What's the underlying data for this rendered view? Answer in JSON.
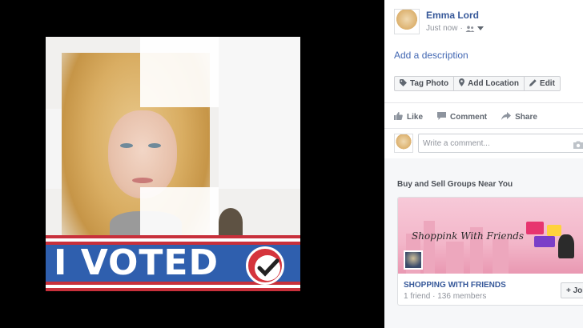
{
  "post": {
    "author": "Emma Lord",
    "timestamp": "Just now",
    "separator": "·",
    "description_link": "Add a description"
  },
  "photo": {
    "banner_text": "I VOTED"
  },
  "tools": {
    "tag_photo": "Tag Photo",
    "add_location": "Add Location",
    "edit": "Edit"
  },
  "actions": {
    "like": "Like",
    "comment": "Comment",
    "share": "Share"
  },
  "comment": {
    "placeholder": "Write a comment..."
  },
  "suggestions": {
    "title": "Buy and Sell Groups Near You",
    "group": {
      "image_text": "Shoppink With Friends",
      "name": "SHOPPING WITH FRIENDS",
      "meta": "1 friend · 136 members",
      "join_label": "+ Join"
    }
  },
  "icons": {
    "privacy": "friends-icon",
    "dropdown": "caret-down-icon",
    "tag": "tag-icon",
    "location": "location-pin-icon",
    "edit": "pencil-icon",
    "like": "thumbs-up-icon",
    "comment": "speech-bubble-icon",
    "share": "share-arrow-icon",
    "camera": "camera-icon",
    "check": "checkmark-icon"
  },
  "colors": {
    "link": "#365899",
    "accent": "#4267b2",
    "banner_blue": "#2f5fae",
    "banner_red": "#c8303b"
  }
}
